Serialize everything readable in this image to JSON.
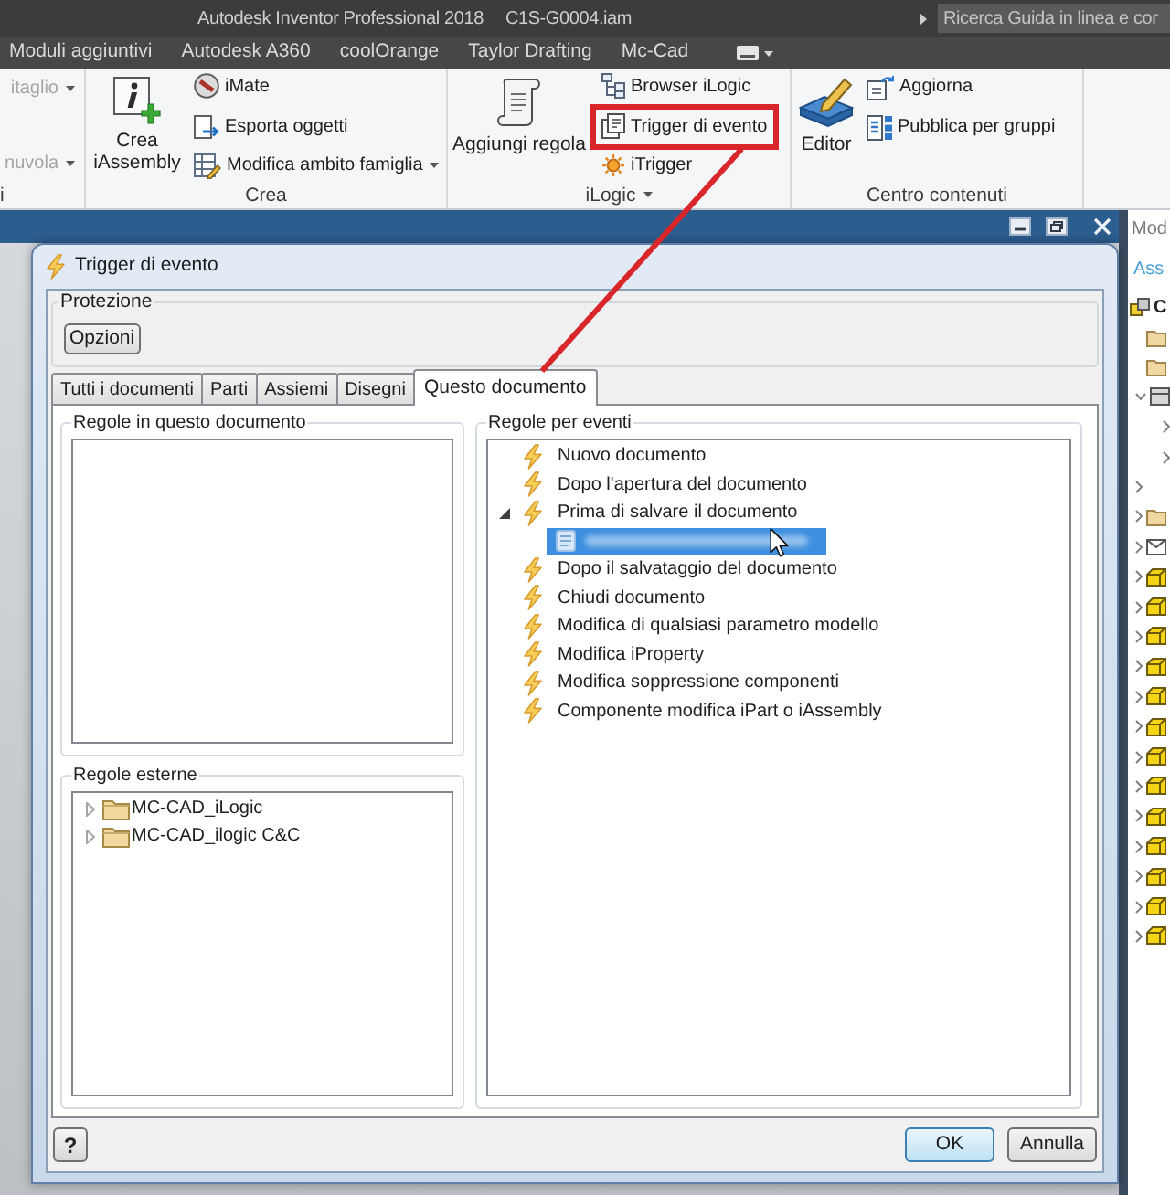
{
  "app": {
    "title": "Autodesk Inventor Professional 2018",
    "document": "C1S-G0004.iam",
    "search": {
      "placeholder": "Ricerca Guida in linea e cor"
    }
  },
  "ribbon_tabs": [
    "Moduli aggiuntivi",
    "Autodesk A360",
    "coolOrange",
    "Taylor Drafting",
    "Mc-Cad"
  ],
  "ribbon": {
    "panels": [
      {
        "label": "i",
        "menu": false,
        "items": [
          {
            "label": "itaglio",
            "disabled": true,
            "dropdown": true,
            "highlighted": false
          },
          {
            "label": "nuvola",
            "disabled": true,
            "dropdown": true,
            "highlighted": false
          }
        ]
      },
      {
        "label": "Crea",
        "menu": false,
        "large_button": "Crea iAssembly",
        "items": [
          {
            "label": "iMate",
            "disabled": false,
            "dropdown": false,
            "highlighted": false
          },
          {
            "label": "Esporta oggetti",
            "disabled": false,
            "dropdown": false,
            "highlighted": false
          },
          {
            "label": "Modifica ambito famiglia",
            "disabled": false,
            "dropdown": true,
            "highlighted": false
          }
        ]
      },
      {
        "label": "iLogic",
        "menu": true,
        "large_button": "Aggiungi regola",
        "items": [
          {
            "label": "Browser iLogic",
            "disabled": false,
            "dropdown": false,
            "highlighted": false
          },
          {
            "label": "Trigger di evento",
            "disabled": false,
            "dropdown": false,
            "highlighted": true
          },
          {
            "label": "iTrigger",
            "disabled": false,
            "dropdown": false,
            "highlighted": false
          }
        ]
      },
      {
        "label": "Centro contenuti",
        "menu": false,
        "large_button": "Editor",
        "items": [
          {
            "label": "Aggiorna",
            "disabled": false,
            "dropdown": false,
            "highlighted": false
          },
          {
            "label": "Pubblica per gruppi",
            "disabled": false,
            "dropdown": false,
            "highlighted": false
          }
        ]
      }
    ]
  },
  "browser": {
    "title": "Mod",
    "tab": "Ass",
    "tree": [
      {
        "kind": "assembly",
        "label": "C",
        "children": [
          {
            "kind": "folder"
          },
          {
            "kind": "folder"
          },
          {
            "kind": "component",
            "expanded": true,
            "children": [
              {
                "expanded": false
              },
              {
                "expanded": false
              }
            ]
          },
          {
            "expanded": false
          },
          {
            "kind": "folder",
            "expanded": false
          },
          {
            "kind": "envelope",
            "expanded": false
          },
          {
            "kind": "part",
            "expanded": false
          },
          {
            "kind": "part",
            "expanded": false
          },
          {
            "kind": "part",
            "expanded": false
          },
          {
            "kind": "part",
            "expanded": false
          },
          {
            "kind": "part",
            "expanded": false
          },
          {
            "kind": "part",
            "expanded": false
          },
          {
            "kind": "part",
            "expanded": false
          },
          {
            "kind": "part",
            "expanded": false
          },
          {
            "kind": "part",
            "expanded": false
          },
          {
            "kind": "part",
            "expanded": false
          },
          {
            "kind": "part",
            "expanded": false
          },
          {
            "kind": "part",
            "expanded": false
          },
          {
            "kind": "part",
            "expanded": false
          }
        ]
      }
    ]
  },
  "dialog": {
    "title": "Trigger di evento",
    "protection": {
      "label": "Protezione",
      "button": "Opzioni"
    },
    "tabs": [
      {
        "label": "Tutti i documenti",
        "selected": false
      },
      {
        "label": "Parti",
        "selected": false
      },
      {
        "label": "Assiemi",
        "selected": false
      },
      {
        "label": "Disegni",
        "selected": false
      },
      {
        "label": "Questo documento",
        "selected": true
      }
    ],
    "document_rules": {
      "label": "Regole in questo documento"
    },
    "external_rules": {
      "label": "Regole esterne",
      "items": [
        {
          "label": "MC-CAD_iLogic",
          "expanded": false
        },
        {
          "label": "MC-CAD_ilogic C&C",
          "expanded": false
        }
      ]
    },
    "event_rules": {
      "label": "Regole per eventi",
      "items": [
        {
          "label": "Nuovo documento"
        },
        {
          "label": "Dopo l'apertura del documento"
        },
        {
          "label": "Prima di salvare il documento",
          "expanded": true,
          "children": [
            {
              "selected": true
            }
          ]
        },
        {
          "label": "Dopo il salvataggio del documento"
        },
        {
          "label": "Chiudi documento"
        },
        {
          "label": "Modifica di qualsiasi parametro modello"
        },
        {
          "label": "Modifica iProperty"
        },
        {
          "label": "Modifica soppressione componenti"
        },
        {
          "label": "Componente modifica iPart o iAssembly"
        }
      ]
    },
    "help_button": "?",
    "buttons": [
      {
        "label": "OK",
        "default": true
      },
      {
        "label": "Annulla",
        "default": false
      }
    ]
  }
}
